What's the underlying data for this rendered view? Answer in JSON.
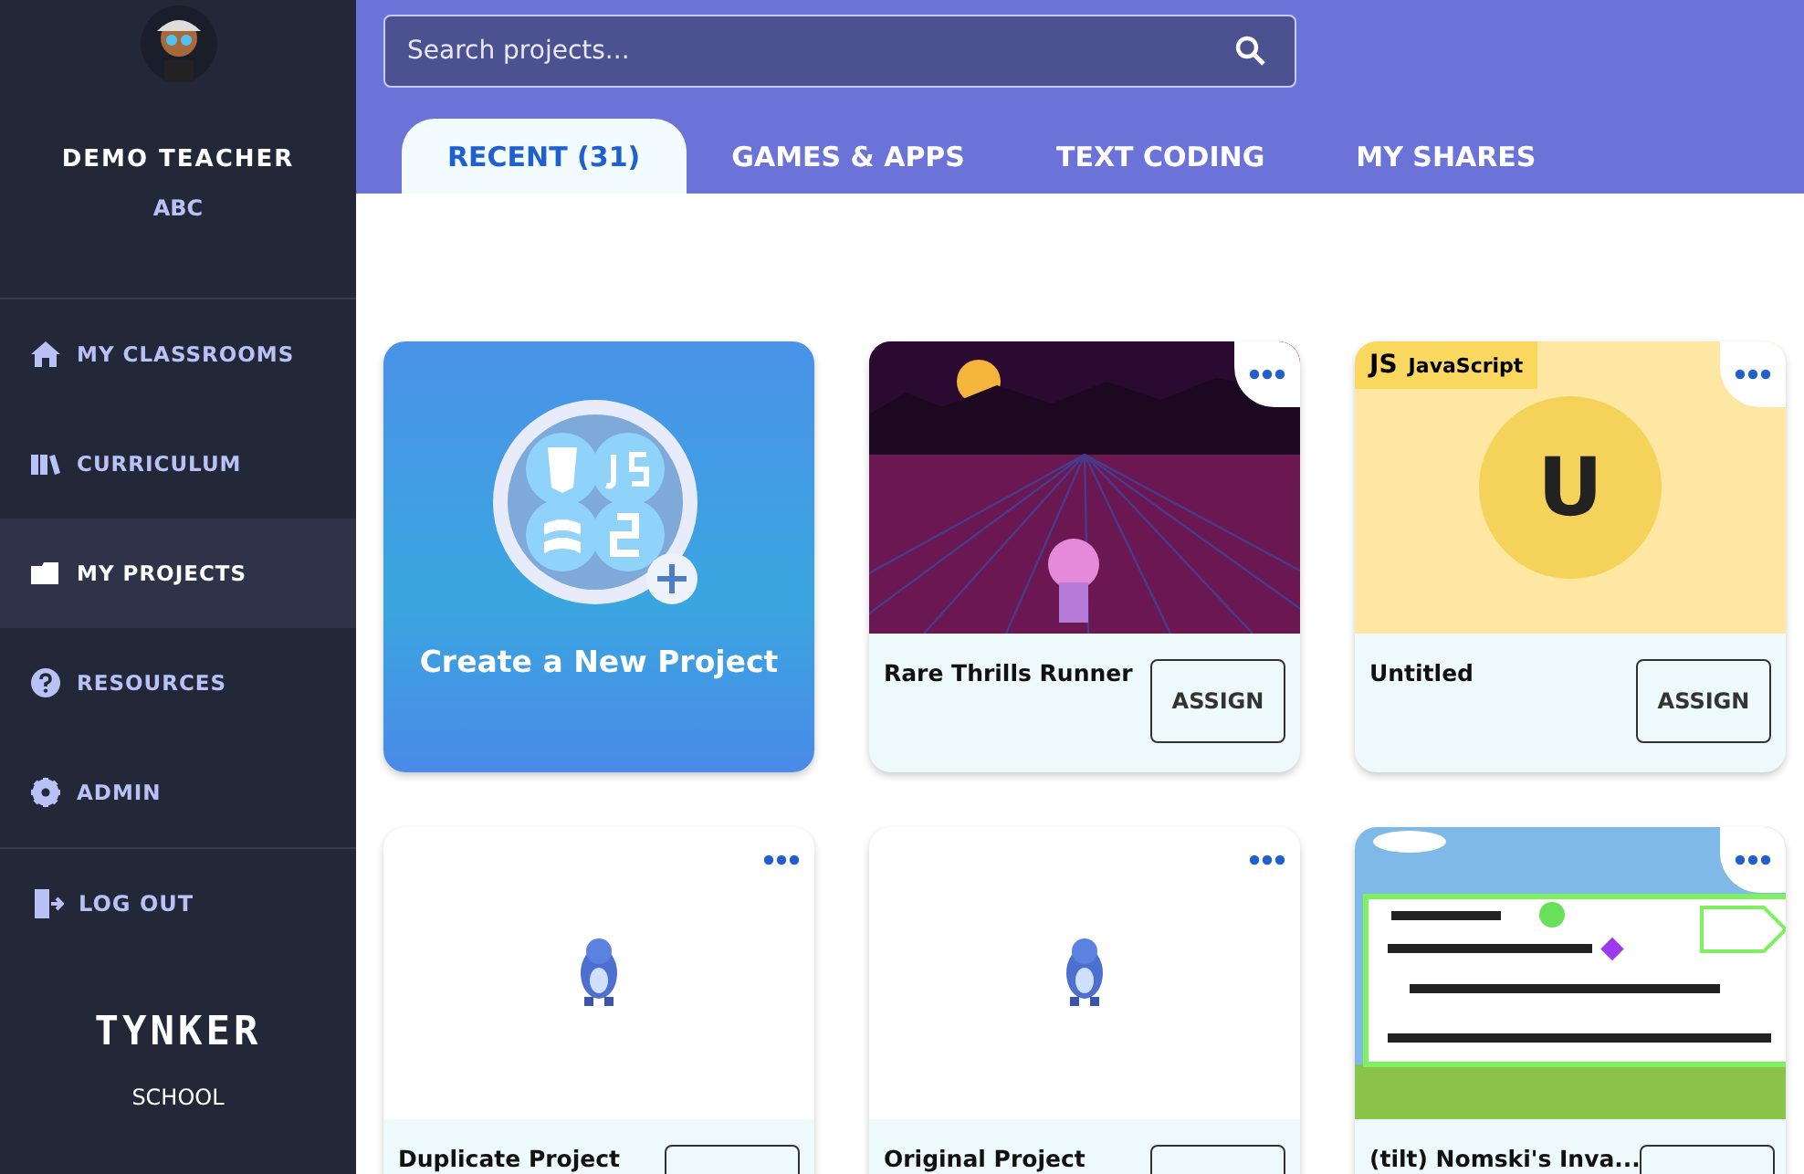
{
  "sidebar": {
    "user": {
      "name": "DEMO TEACHER",
      "org": "ABC"
    },
    "items": [
      {
        "label": "MY CLASSROOMS",
        "selected": false
      },
      {
        "label": "CURRICULUM",
        "selected": false
      },
      {
        "label": "MY PROJECTS",
        "selected": true
      },
      {
        "label": "RESOURCES",
        "selected": false
      },
      {
        "label": "ADMIN",
        "selected": false
      }
    ],
    "logout": "LOG OUT",
    "logo": "TYNKER",
    "logo_sub": "SCHOOL"
  },
  "search": {
    "placeholder": "Search projects..."
  },
  "tabs": [
    {
      "label": "RECENT (31)",
      "selected": true
    },
    {
      "label": "GAMES & APPS",
      "selected": false
    },
    {
      "label": "TEXT CODING",
      "selected": false
    },
    {
      "label": "MY SHARES",
      "selected": false
    }
  ],
  "cards": [
    {
      "kind": "create",
      "title": "Create a New Project"
    },
    {
      "kind": "project",
      "title": "Rare Thrills Runner",
      "button": "ASSIGN"
    },
    {
      "kind": "project",
      "title": "Untitled",
      "thumbnail": {
        "kind": "language",
        "badge_icon": "JS",
        "badge": "JavaScript",
        "letter": "U"
      },
      "button": "ASSIGN"
    },
    {
      "kind": "project",
      "title": "Duplicate Project"
    },
    {
      "kind": "project",
      "title": "Original Project"
    },
    {
      "kind": "project",
      "title": "(tilt) Nomski's Inva..."
    }
  ]
}
